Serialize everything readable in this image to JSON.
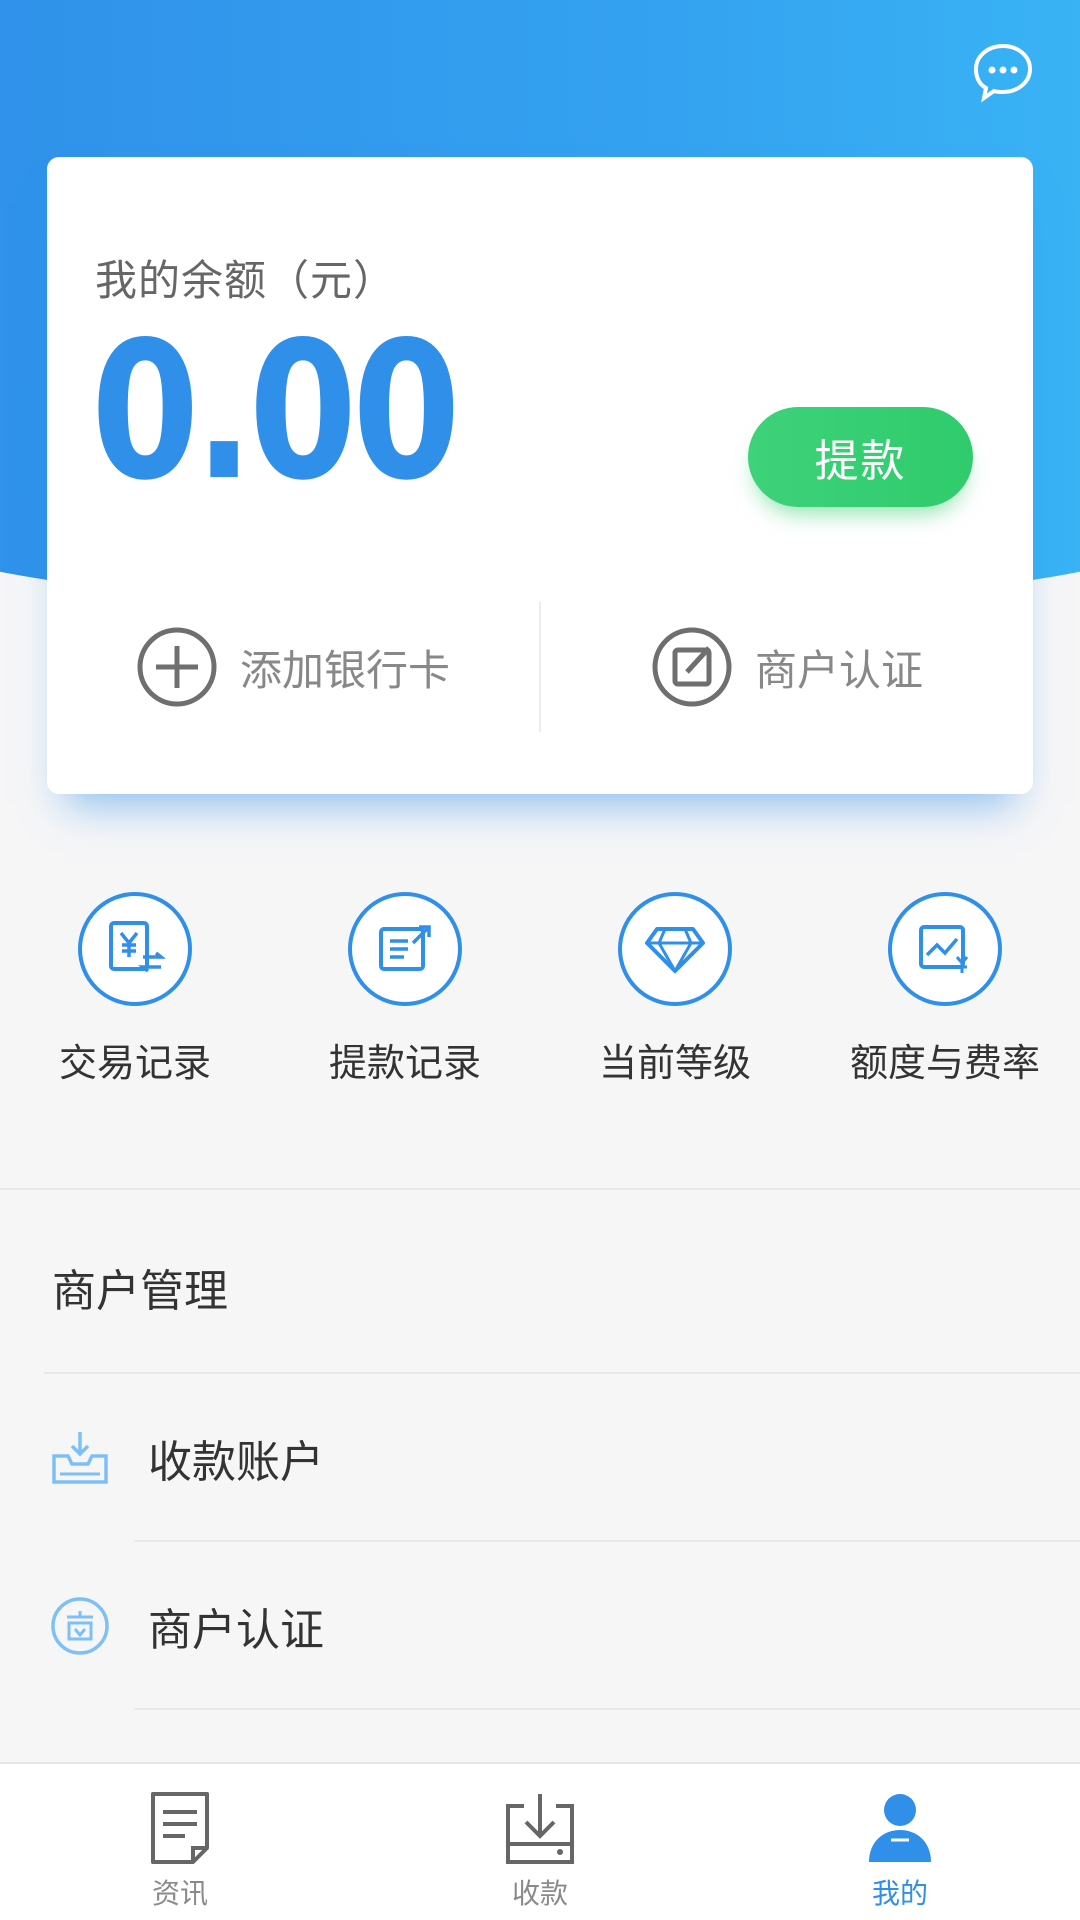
{
  "header": {
    "message_icon": "chat-bubble-icon"
  },
  "balance_card": {
    "label": "我的余额（元）",
    "amount": "0.00",
    "withdraw_label": "提款",
    "actions": [
      {
        "label": "添加银行卡",
        "icon": "plus-circle-icon"
      },
      {
        "label": "商户认证",
        "icon": "edit-circle-icon"
      }
    ]
  },
  "quick_menu": [
    {
      "label": "交易记录",
      "icon": "yen-exchange-icon"
    },
    {
      "label": "提款记录",
      "icon": "withdraw-record-icon"
    },
    {
      "label": "当前等级",
      "icon": "diamond-icon"
    },
    {
      "label": "额度与费率",
      "icon": "rate-chart-icon"
    }
  ],
  "merchant_section": {
    "title": "商户管理",
    "items": [
      {
        "label": "收款账户",
        "icon": "receive-tray-icon"
      },
      {
        "label": "商户认证",
        "icon": "merchant-badge-icon"
      }
    ]
  },
  "tabbar": {
    "tabs": [
      {
        "label": "资讯",
        "icon": "news-doc-icon",
        "active": false
      },
      {
        "label": "收款",
        "icon": "download-tray-icon",
        "active": false
      },
      {
        "label": "我的",
        "icon": "user-icon",
        "active": true
      }
    ]
  },
  "colors": {
    "primary": "#2f8fe9",
    "success": "#2fcb6c",
    "text": "#333333",
    "muted": "#888888"
  }
}
